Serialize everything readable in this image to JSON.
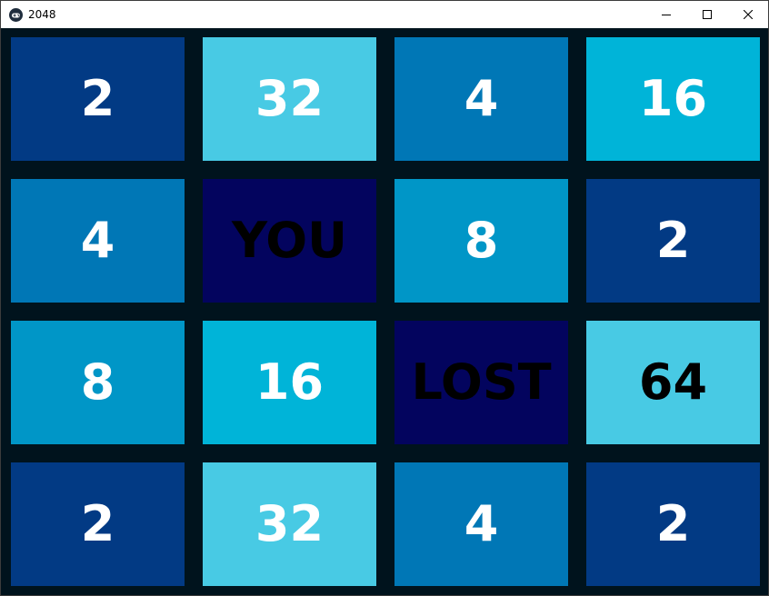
{
  "window": {
    "title": "2048",
    "icon": "gamepad-icon",
    "controls": [
      "minimize-icon",
      "maximize-icon",
      "close-icon"
    ]
  },
  "board": {
    "background": "#00131d",
    "status": "YOU LOST",
    "tiles": [
      [
        {
          "label": "2",
          "bg": "#023a84",
          "fg": "#ffffff"
        },
        {
          "label": "32",
          "bg": "#48cae4",
          "fg": "#ffffff"
        },
        {
          "label": "4",
          "bg": "#0077b6",
          "fg": "#ffffff"
        },
        {
          "label": "16",
          "bg": "#00b4d8",
          "fg": "#ffffff"
        }
      ],
      [
        {
          "label": "4",
          "bg": "#0077b6",
          "fg": "#ffffff"
        },
        {
          "label": "YOU",
          "bg": "#03045e",
          "fg": "#000000"
        },
        {
          "label": "8",
          "bg": "#0096c7",
          "fg": "#ffffff"
        },
        {
          "label": "2",
          "bg": "#023a84",
          "fg": "#ffffff"
        }
      ],
      [
        {
          "label": "8",
          "bg": "#0096c7",
          "fg": "#ffffff"
        },
        {
          "label": "16",
          "bg": "#00b4d8",
          "fg": "#ffffff"
        },
        {
          "label": "LOST",
          "bg": "#03045e",
          "fg": "#000000"
        },
        {
          "label": "64",
          "bg": "#48cae4",
          "fg": "#000000"
        }
      ],
      [
        {
          "label": "2",
          "bg": "#023a84",
          "fg": "#ffffff"
        },
        {
          "label": "32",
          "bg": "#48cae4",
          "fg": "#ffffff"
        },
        {
          "label": "4",
          "bg": "#0077b6",
          "fg": "#ffffff"
        },
        {
          "label": "2",
          "bg": "#023a84",
          "fg": "#ffffff"
        }
      ]
    ]
  }
}
